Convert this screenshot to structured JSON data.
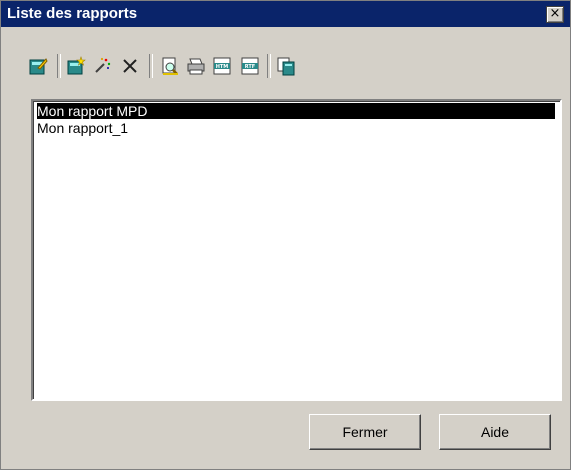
{
  "window": {
    "title": "Liste des rapports",
    "close_label": "×"
  },
  "toolbar": {
    "buttons": [
      {
        "name": "properties",
        "label": "Propriétés"
      },
      {
        "name": "new-report",
        "label": "Nouveau"
      },
      {
        "name": "wizard",
        "label": "Assistant"
      },
      {
        "name": "delete",
        "label": "Supprimer"
      },
      {
        "name": "print-preview",
        "label": "Aperçu"
      },
      {
        "name": "print",
        "label": "Imprimer"
      },
      {
        "name": "generate-html",
        "label": "HTML"
      },
      {
        "name": "generate-rtf",
        "label": "RTF"
      },
      {
        "name": "copy",
        "label": "Copier"
      }
    ]
  },
  "reports": {
    "items": [
      "Mon rapport MPD",
      "Mon rapport_1"
    ],
    "selected_index": 0
  },
  "buttons": {
    "close": "Fermer",
    "help": "Aide"
  },
  "colors": {
    "titlebar": "#0a246a",
    "face": "#d4d0c8",
    "selection": "#000000"
  }
}
